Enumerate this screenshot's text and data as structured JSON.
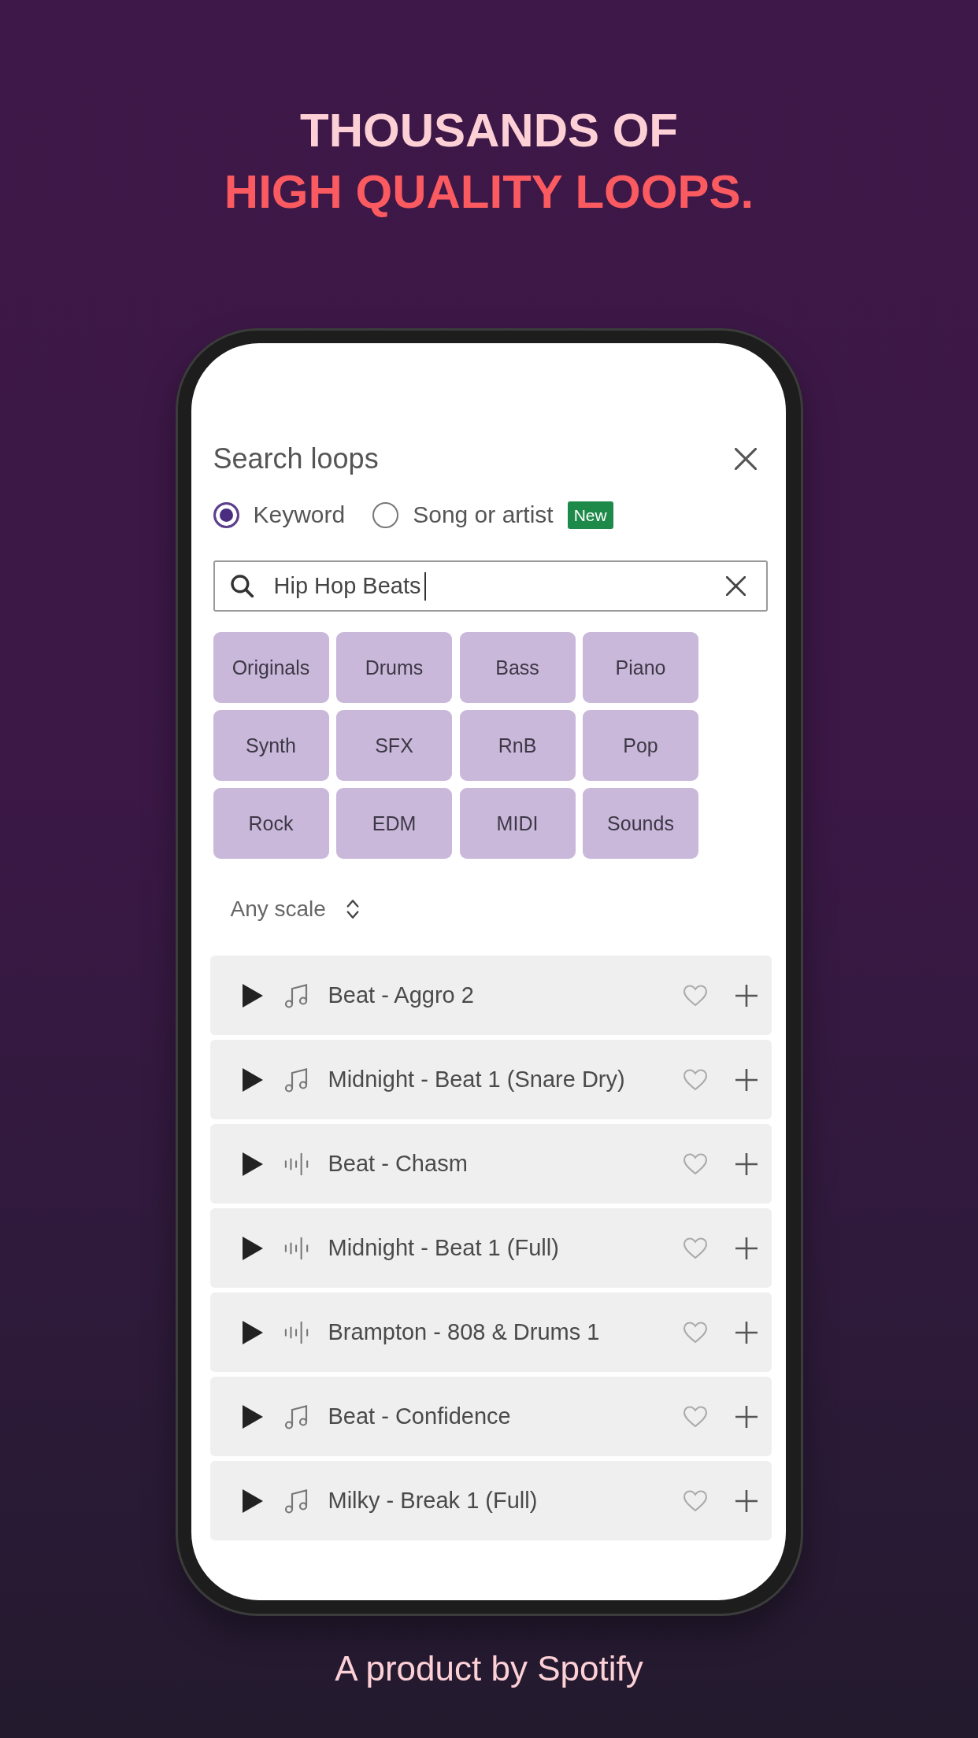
{
  "headline": {
    "line_1": "THOUSANDS OF",
    "line_2": "HIGH QUALITY LOOPS."
  },
  "dialog": {
    "title": "Search loops",
    "search_modes": [
      {
        "label": "Keyword",
        "selected": true
      },
      {
        "label": "Song or artist",
        "selected": false,
        "badge": "New"
      }
    ],
    "search": {
      "value": "Hip Hop Beats",
      "focused": true
    },
    "categories": [
      "Originals",
      "Drums",
      "Bass",
      "Piano",
      "Synth",
      "SFX",
      "RnB",
      "Pop",
      "Rock",
      "EDM",
      "MIDI",
      "Sounds"
    ],
    "scale_filter": {
      "value": "Any scale"
    },
    "loops": [
      {
        "title": "Beat - Aggro 2",
        "kind": "notes",
        "liked": false
      },
      {
        "title": "Midnight - Beat 1 (Snare Dry)",
        "kind": "notes",
        "liked": false
      },
      {
        "title": "Beat - Chasm",
        "kind": "waveform",
        "liked": false
      },
      {
        "title": "Midnight - Beat 1 (Full)",
        "kind": "waveform",
        "liked": false
      },
      {
        "title": "Brampton - 808 & Drums 1",
        "kind": "waveform",
        "liked": false
      },
      {
        "title": "Beat - Confidence",
        "kind": "notes",
        "liked": false
      },
      {
        "title": "Milky - Break 1 (Full)",
        "kind": "notes",
        "liked": false
      }
    ]
  },
  "footer": "A product by Spotify"
}
